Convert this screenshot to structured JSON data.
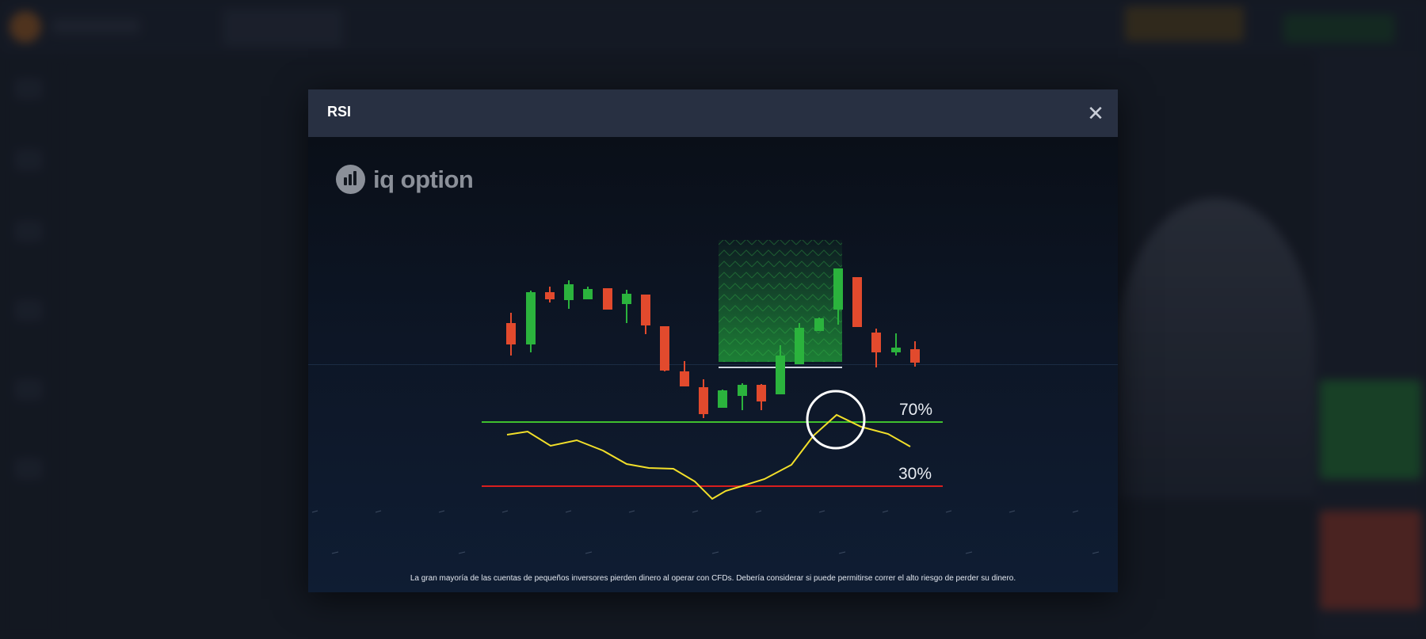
{
  "modal": {
    "title": "RSI",
    "close_icon": "close-icon",
    "close_label": "✕"
  },
  "brand": {
    "name": "iq option",
    "icon": "iq-option-logo-icon"
  },
  "chart_data": {
    "type": "candlestick-with-indicator",
    "indicator": "RSI",
    "levels": [
      {
        "label": "70%",
        "value": 70,
        "color": "#3fbf2e"
      },
      {
        "label": "30%",
        "value": 30,
        "color": "#d81e1e"
      }
    ],
    "highlight": "RSI crossing above 70% level",
    "colors": {
      "up": "#2bb33d",
      "down": "#e24a2d",
      "rsi_line": "#f2df2a",
      "highlight_zone": "#22a23a"
    }
  },
  "disclaimer": "La gran mayoría de las cuentas de pequeños inversores pierden dinero al operar con CFDs. Debería considerar si puede permitirse correr el alto riesgo de perder su dinero."
}
